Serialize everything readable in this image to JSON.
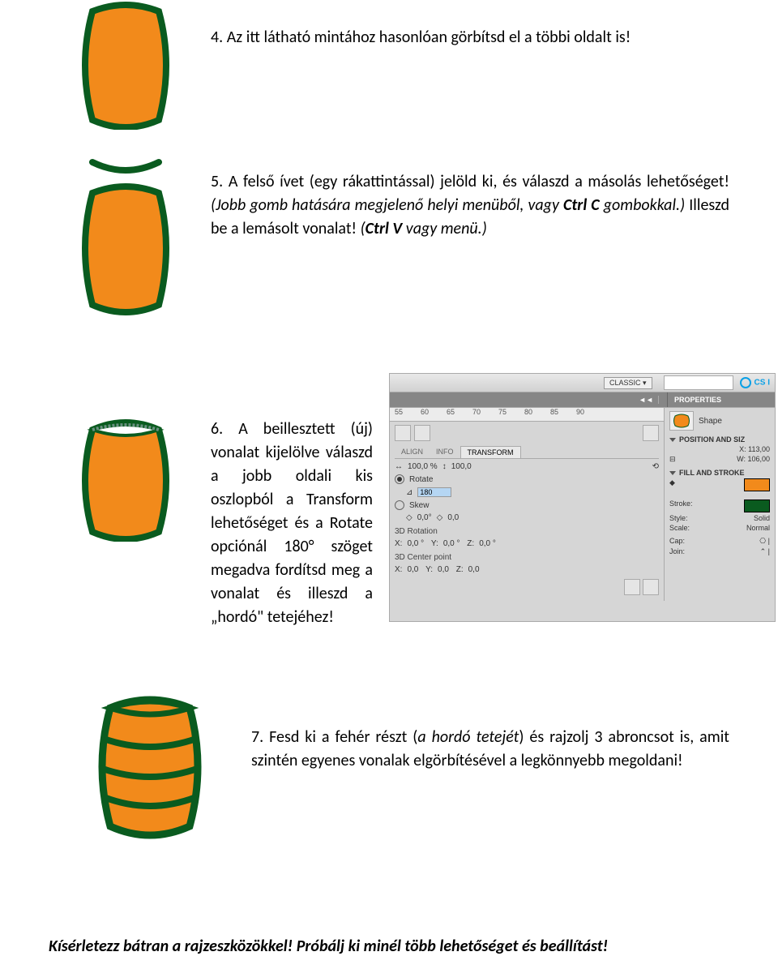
{
  "step4": {
    "text": "4. Az itt látható mintához hasonlóan görbítsd el a többi oldalt is!"
  },
  "step5": {
    "prefix": "5. A felső ívet (egy rákattintással) jelöld ki, és válaszd a másolás lehetőséget! ",
    "italic1": "(Jobb gomb hatására megjelenő helyi menüből, vagy ",
    "bold1": "Ctrl C",
    "italic2": " gombokkal.)",
    "mid": " Illeszd be a lemásolt vonalat! ",
    "italic3": "(",
    "bold2": "Ctrl V",
    "italic4": " vagy menü.)"
  },
  "step6": {
    "text": "6. A beillesztett (új) vonalat kijelölve válaszd a jobb oldali kis oszlopból a Transform lehetőséget és a Rotate opciónál 180° szöget megadva fordítsd meg a vonalat és illeszd a „hordó\" tetejéhez!"
  },
  "step7": {
    "prefix": "7. Fesd ki a fehér részt (",
    "italic1": "a hordó tetejét",
    "suffix": ") és rajzolj 3 abroncsot is, amit szintén egyenes vonalak elgörbítésével a legkönnyebb megoldani!"
  },
  "footer": "Kísérletezz bátran a rajzeszközökkel! Próbálj ki minél több lehetőséget és beállítást!",
  "panel": {
    "classic_label": "CLASSIC ▾",
    "cs_label": "CS I",
    "ruler": [
      "55",
      "60",
      "65",
      "70",
      "75",
      "80",
      "85",
      "90"
    ],
    "props_label": "PROPERTIES",
    "tabs": {
      "align": "ALIGN",
      "info": "INFO",
      "transform": "TRANSFORM"
    },
    "scale": {
      "x": "100,0 %",
      "y": "100,0"
    },
    "rotate_label": "Rotate",
    "rotate_value": "180",
    "skew_label": "Skew",
    "skew_x": "0,0°",
    "skew_y": "0,0",
    "rot3d_label": "3D Rotation",
    "rot3d": {
      "x": "0,0 °",
      "y": "0,0 °",
      "z": "0,0 °"
    },
    "center_label": "3D Center point",
    "center": {
      "x": "0,0",
      "y": "0,0",
      "z": "0,0"
    },
    "right": {
      "shape_label": "Shape",
      "pos_label": "POSITION AND SIZ",
      "x_val": "X:   113,00",
      "w_val": "W:   106,00",
      "fs_label": "FILL AND STROKE",
      "stroke_label": "Stroke:",
      "style_label": "Style:",
      "style_val": "Solid",
      "scale_label": "Scale:",
      "scale_val": "Normal",
      "cap_label": "Cap:",
      "cap_val": "⎔ |",
      "join_label": "Join:",
      "join_val": "⌃ |"
    }
  }
}
